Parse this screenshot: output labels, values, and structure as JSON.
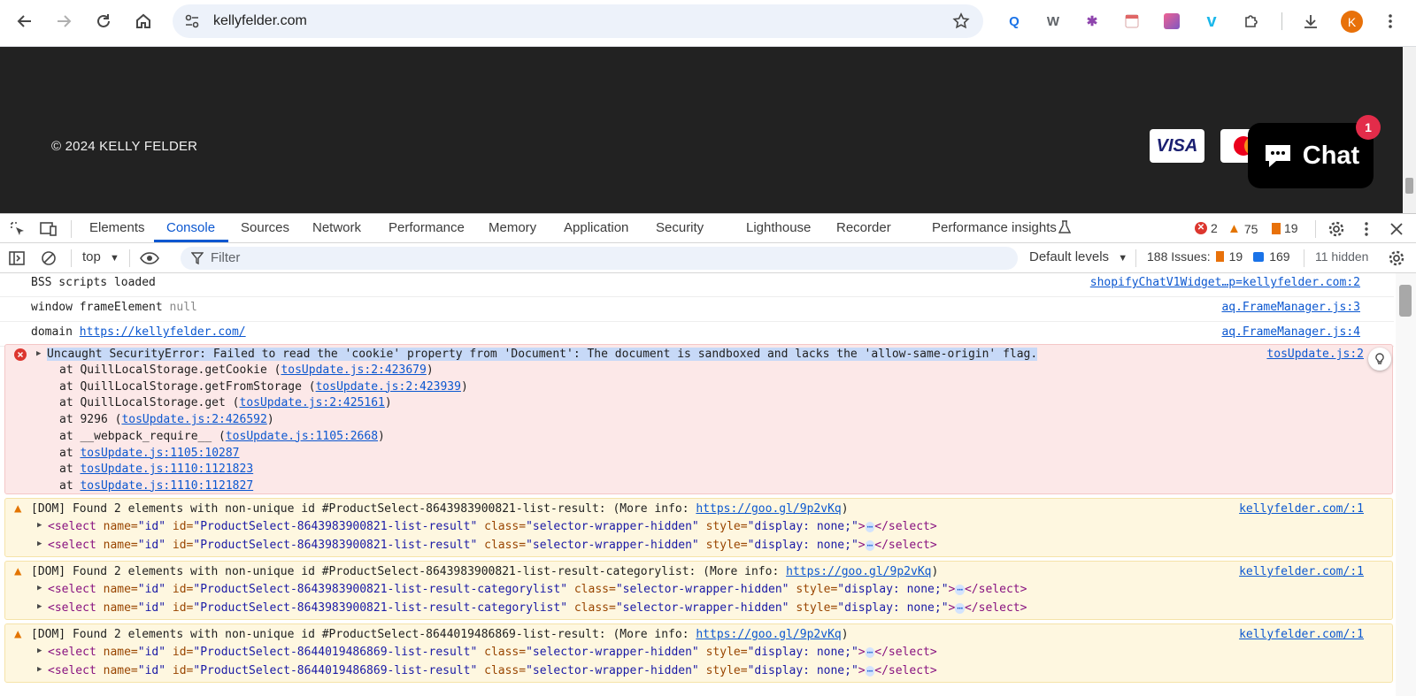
{
  "browser": {
    "url": "kellyfelder.com",
    "avatar_letter": "K"
  },
  "site": {
    "copyright": "© 2024 KELLY FELDER",
    "visa": "VISA",
    "chat_label": "Chat",
    "chat_badge": "1"
  },
  "devtools": {
    "tabs": [
      "Elements",
      "Console",
      "Sources",
      "Network",
      "Performance",
      "Memory",
      "Application",
      "Security",
      "Lighthouse",
      "Recorder",
      "Performance insights"
    ],
    "active_tab": "Console",
    "error_count": "2",
    "warning_count": "75",
    "issue_count": "19",
    "context": "top",
    "filter_placeholder": "Filter",
    "levels": "Default levels",
    "issues_label": "188 Issues:",
    "issues_warn": "19",
    "issues_info": "169",
    "hidden": "11 hidden"
  },
  "console": {
    "m1_text": "BSS scripts loaded",
    "m1_src": "shopifyChatV1Widget…p=kellyfelder.com:2",
    "m2_text": "window frameElement",
    "m2_null": "null",
    "m2_src": "aq.FrameManager.js:3",
    "m3_text": "domain",
    "m3_link": "https://kellyfelder.com/",
    "m3_src": "aq.FrameManager.js:4",
    "err_main": "Uncaught SecurityError: Failed to read the 'cookie' property from 'Document': The document is sandboxed and lacks the 'allow-same-origin' flag.",
    "err_src": "tosUpdate.js:2",
    "stack": [
      {
        "pre": "at QuillLocalStorage.getCookie (",
        "link": "tosUpdate.js:2:423679",
        "post": ")"
      },
      {
        "pre": "at QuillLocalStorage.getFromStorage (",
        "link": "tosUpdate.js:2:423939",
        "post": ")"
      },
      {
        "pre": "at QuillLocalStorage.get (",
        "link": "tosUpdate.js:2:425161",
        "post": ")"
      },
      {
        "pre": "at 9296 (",
        "link": "tosUpdate.js:2:426592",
        "post": ")"
      },
      {
        "pre": "at __webpack_require__ (",
        "link": "tosUpdate.js:1105:2668",
        "post": ")"
      },
      {
        "pre": "at ",
        "link": "tosUpdate.js:1105:10287",
        "post": ""
      },
      {
        "pre": "at ",
        "link": "tosUpdate.js:1110:1121823",
        "post": ""
      },
      {
        "pre": "at ",
        "link": "tosUpdate.js:1110:1121827",
        "post": ""
      }
    ],
    "warnings": [
      {
        "text": "[DOM] Found 2 elements with non-unique id #ProductSelect-8643983900821-list-result: (More info: ",
        "link": "https://goo.gl/9p2vKq",
        "close": ")",
        "src": "kellyfelder.com/:1",
        "id_val": "\"ProductSelect-8643983900821-list-result\""
      },
      {
        "text": "[DOM] Found 2 elements with non-unique id #ProductSelect-8643983900821-list-result-categorylist: (More info: ",
        "link": "https://goo.gl/9p2vKq",
        "close": ")",
        "src": "kellyfelder.com/:1",
        "id_val": "\"ProductSelect-8643983900821-list-result-categorylist\""
      },
      {
        "text": "[DOM] Found 2 elements with non-unique id #ProductSelect-8644019486869-list-result: (More info: ",
        "link": "https://goo.gl/9p2vKq",
        "close": ")",
        "src": "kellyfelder.com/:1",
        "id_val": "\"ProductSelect-8644019486869-list-result\""
      }
    ],
    "el_open": "<select",
    "el_name": "name=",
    "el_name_val": "\"id\"",
    "el_id": "id=",
    "el_class": "class=",
    "el_class_val": "\"selector-wrapper-hidden\"",
    "el_style": "style=",
    "el_style_val": "\"display: none;\"",
    "el_gt": ">",
    "el_ell": "⋯",
    "el_close": "</select>"
  }
}
